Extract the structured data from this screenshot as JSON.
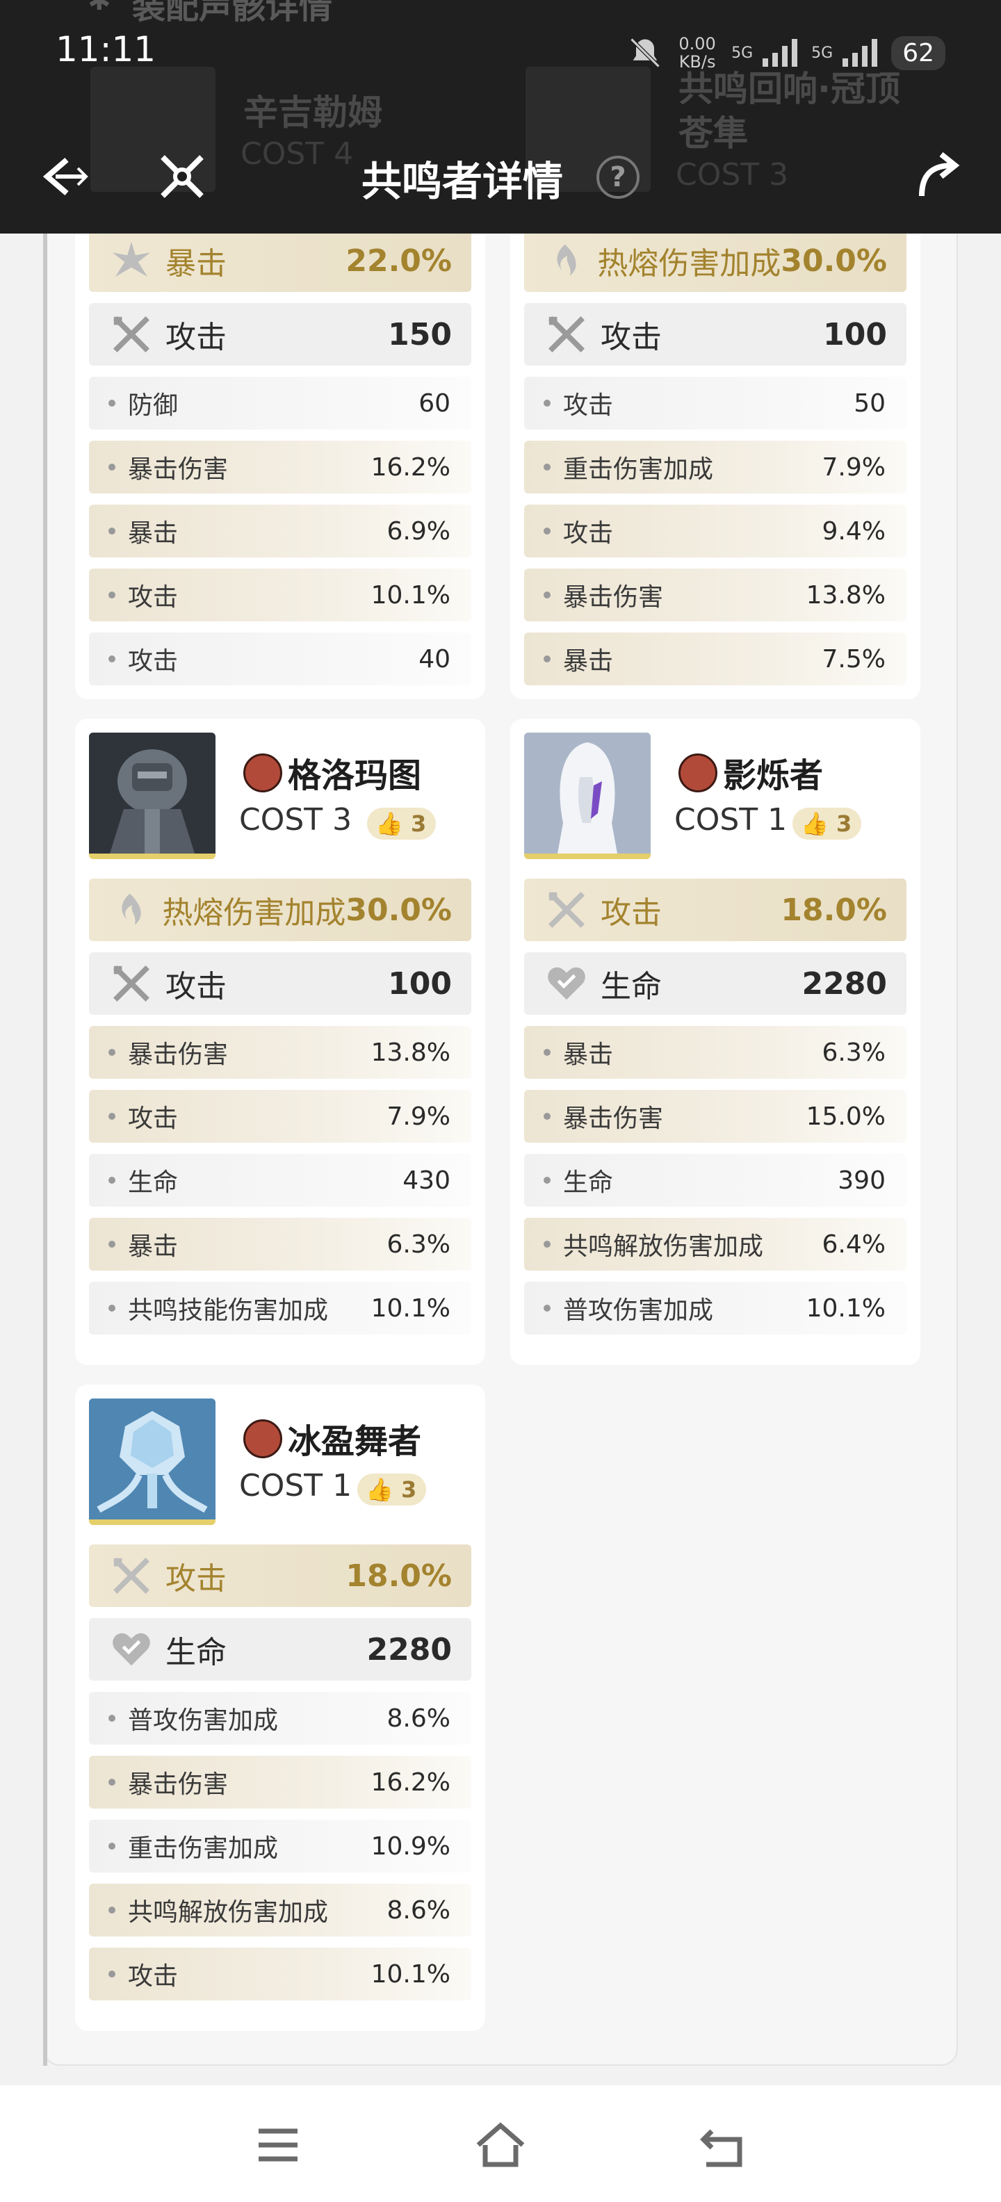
{
  "status_bar": {
    "time": "11:11",
    "net_speed": "0.00 KB/s",
    "net_5g_1": "5G",
    "net_5g_2": "5G",
    "battery": "62"
  },
  "background_header": {
    "section_heading": "装配声骸详情",
    "ghost_left_name": "辛吉勒姆",
    "ghost_left_cost": "COST 4",
    "ghost_right_name": "共鸣回响·冠顶苍隼",
    "ghost_right_cost": "COST 3"
  },
  "title_bar": {
    "title": "共鸣者详情",
    "help": "?"
  },
  "cards": [
    {
      "name": "",
      "cost": "",
      "tune": "",
      "main": {
        "label": "暴击",
        "value": "22.0%",
        "icon": "crit-icon",
        "style": "gold"
      },
      "secondary": {
        "label": "攻击",
        "value": "150",
        "icon": "sword-icon"
      },
      "subs": [
        {
          "label": "防御",
          "value": "60"
        },
        {
          "label": "暴击伤害",
          "value": "16.2%"
        },
        {
          "label": "暴击",
          "value": "6.9%"
        },
        {
          "label": "攻击",
          "value": "10.1%"
        },
        {
          "label": "攻击",
          "value": "40"
        }
      ]
    },
    {
      "name": "",
      "cost": "",
      "tune": "",
      "main": {
        "label": "热熔伤害加成",
        "value": "30.0%",
        "icon": "fusion-icon",
        "style": "gold"
      },
      "secondary": {
        "label": "攻击",
        "value": "100",
        "icon": "sword-icon"
      },
      "subs": [
        {
          "label": "攻击",
          "value": "50"
        },
        {
          "label": "重击伤害加成",
          "value": "7.9%"
        },
        {
          "label": "攻击",
          "value": "9.4%"
        },
        {
          "label": "暴击伤害",
          "value": "13.8%"
        },
        {
          "label": "暴击",
          "value": "7.5%"
        }
      ]
    },
    {
      "name": "格洛玛图",
      "cost": "COST 3",
      "tune": "3",
      "main": {
        "label": "热熔伤害加成",
        "value": "30.0%",
        "icon": "fusion-icon",
        "style": "gold"
      },
      "secondary": {
        "label": "攻击",
        "value": "100",
        "icon": "sword-icon"
      },
      "subs": [
        {
          "label": "暴击伤害",
          "value": "13.8%"
        },
        {
          "label": "攻击",
          "value": "7.9%"
        },
        {
          "label": "生命",
          "value": "430"
        },
        {
          "label": "暴击",
          "value": "6.3%"
        },
        {
          "label": "共鸣技能伤害加成",
          "value": "10.1%"
        }
      ]
    },
    {
      "name": "影烁者",
      "cost": "COST 1",
      "tune": "3",
      "main": {
        "label": "攻击",
        "value": "18.0%",
        "icon": "sword-icon",
        "style": "gold"
      },
      "secondary": {
        "label": "生命",
        "value": "2280",
        "icon": "heart-icon"
      },
      "subs": [
        {
          "label": "暴击",
          "value": "6.3%"
        },
        {
          "label": "暴击伤害",
          "value": "15.0%"
        },
        {
          "label": "生命",
          "value": "390"
        },
        {
          "label": "共鸣解放伤害加成",
          "value": "6.4%"
        },
        {
          "label": "普攻伤害加成",
          "value": "10.1%"
        }
      ]
    },
    {
      "name": "冰盈舞者",
      "cost": "COST 1",
      "tune": "3",
      "main": {
        "label": "攻击",
        "value": "18.0%",
        "icon": "sword-icon",
        "style": "gold"
      },
      "secondary": {
        "label": "生命",
        "value": "2280",
        "icon": "heart-icon"
      },
      "subs": [
        {
          "label": "普攻伤害加成",
          "value": "8.6%"
        },
        {
          "label": "暴击伤害",
          "value": "16.2%"
        },
        {
          "label": "重击伤害加成",
          "value": "10.9%"
        },
        {
          "label": "共鸣解放伤害加成",
          "value": "8.6%"
        },
        {
          "label": "攻击",
          "value": "10.1%"
        }
      ]
    }
  ],
  "colors": {
    "gold_text": "#a3832e",
    "header_bg": "#1f1f1f",
    "card_bg": "#ffffff",
    "page_bg": "#f2f2f2"
  },
  "nav": {
    "menu_icon": "menu-icon",
    "home_icon": "home-icon",
    "back_icon": "back-icon"
  }
}
